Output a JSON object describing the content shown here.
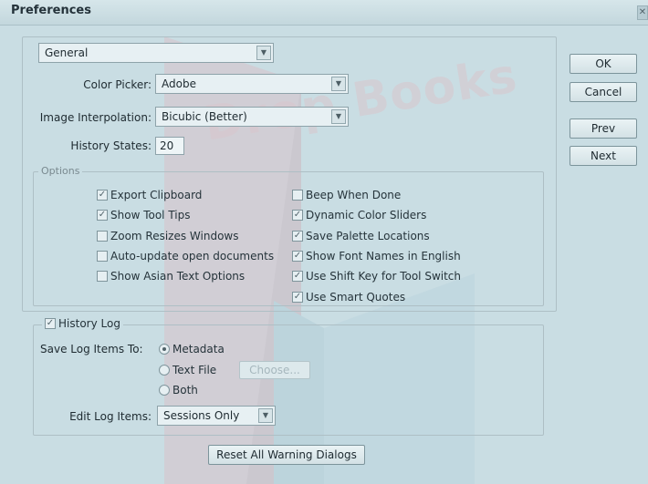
{
  "window": {
    "title": "Preferences",
    "close_glyph": "✕"
  },
  "watermark": {
    "text": "Drop Books"
  },
  "section_select": {
    "value": "General"
  },
  "general": {
    "color_picker": {
      "label": "Color Picker:",
      "value": "Adobe"
    },
    "image_interpolation": {
      "label": "Image Interpolation:",
      "value": "Bicubic (Better)"
    },
    "history_states": {
      "label": "History States:",
      "value": "20"
    }
  },
  "options": {
    "legend": "Options",
    "left": [
      {
        "label": "Export Clipboard",
        "checked": true
      },
      {
        "label": "Show Tool Tips",
        "checked": true
      },
      {
        "label": "Zoom Resizes Windows",
        "checked": false
      },
      {
        "label": "Auto-update open documents",
        "checked": false
      },
      {
        "label": "Show Asian Text Options",
        "checked": false
      }
    ],
    "right": [
      {
        "label": "Beep When Done",
        "checked": false
      },
      {
        "label": "Dynamic Color Sliders",
        "checked": true
      },
      {
        "label": "Save Palette Locations",
        "checked": true
      },
      {
        "label": "Show Font Names in English",
        "checked": true
      },
      {
        "label": "Use Shift Key for Tool Switch",
        "checked": true
      },
      {
        "label": "Use Smart Quotes",
        "checked": true
      }
    ]
  },
  "history_log": {
    "label": "History Log",
    "checked": true,
    "save_to_label": "Save Log Items To:",
    "radios": [
      {
        "label": "Metadata",
        "selected": true
      },
      {
        "label": "Text File",
        "selected": false
      },
      {
        "label": "Both",
        "selected": false
      }
    ],
    "choose_label": "Choose...",
    "edit_label": "Edit Log Items:",
    "edit_value": "Sessions Only"
  },
  "buttons": {
    "ok": "OK",
    "cancel": "Cancel",
    "prev": "Prev",
    "next": "Next",
    "reset": "Reset All Warning Dialogs"
  },
  "icons": {
    "dropdown_arrow": "▼",
    "check": "✓"
  },
  "colors": {
    "background": "#c9dde3",
    "watermark": "#d9c6cd",
    "watermark_blue": "#bfd6e0"
  }
}
